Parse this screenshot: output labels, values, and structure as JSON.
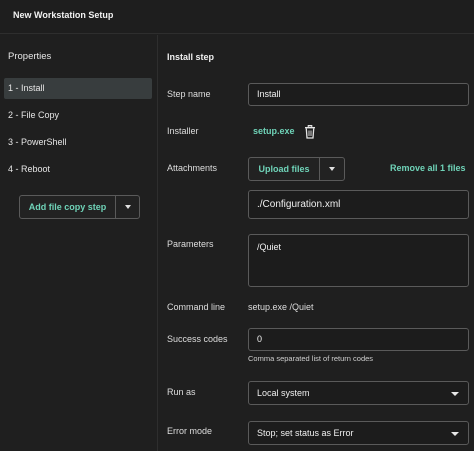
{
  "window": {
    "title": "New Workstation Setup"
  },
  "sidebar": {
    "heading": "Properties",
    "steps": [
      {
        "label": "1 - Install",
        "selected": true
      },
      {
        "label": "2 - File Copy",
        "selected": false
      },
      {
        "label": "3 - PowerShell",
        "selected": false
      },
      {
        "label": "4 - Reboot",
        "selected": false
      }
    ],
    "add_button_label": "Add file copy step"
  },
  "main": {
    "section_title": "Install step",
    "step_name": {
      "label": "Step name",
      "value": "Install"
    },
    "installer": {
      "label": "Installer",
      "value": "setup.exe"
    },
    "attachments": {
      "label": "Attachments",
      "upload_label": "Upload files",
      "remove_all_label": "Remove all 1 files",
      "file_value": "./Configuration.xml"
    },
    "parameters": {
      "label": "Parameters",
      "value": "/Quiet"
    },
    "command_line": {
      "label": "Command line",
      "value": "setup.exe /Quiet"
    },
    "success_codes": {
      "label": "Success codes",
      "value": "0",
      "hint": "Comma separated list of return codes"
    },
    "run_as": {
      "label": "Run as",
      "value": "Local system"
    },
    "error_mode": {
      "label": "Error mode",
      "value": "Stop; set status as Error"
    }
  },
  "colors": {
    "accent": "#6fd3b8",
    "background": "#1f1f1f",
    "selected": "#383d3e",
    "border": "#5a5a5a"
  },
  "icons": {
    "delete_installer": "trash-icon",
    "dropdown": "chevron-down-icon"
  }
}
